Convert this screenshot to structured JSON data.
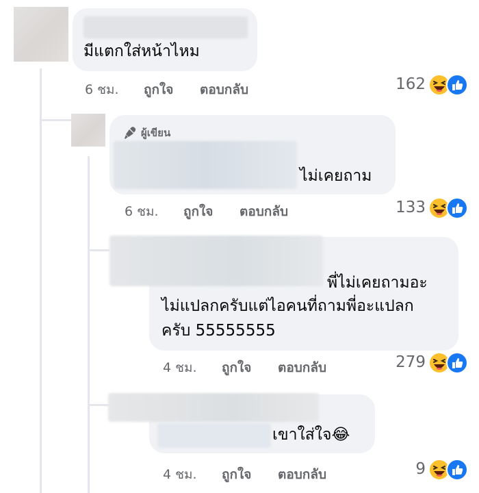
{
  "comments": [
    {
      "text": "มีแตกใส่หน้าไหม",
      "time": "6 ชม.",
      "like": "ถูกใจ",
      "reply": "ตอบกลับ",
      "reactions": "162"
    },
    {
      "badge": "ผู้เขียน",
      "text": "ไม่เคยถาม",
      "time": "6 ชม.",
      "like": "ถูกใจ",
      "reply": "ตอบกลับ",
      "reactions": "133"
    },
    {
      "lines": [
        "พี่ไม่เคยถามอะ",
        "ไม่แปลกครับแต่ไอคนที่ถามพี่อะแปลก",
        "ครับ 55555555"
      ],
      "time": "4 ชม.",
      "like": "ถูกใจ",
      "reply": "ตอบกลับ",
      "reactions": "279"
    },
    {
      "text": "เขาใส่ใจ",
      "emoji": "😂",
      "time": "4 ชม.",
      "like": "ถูกใจ",
      "reply": "ตอบกลับ",
      "reactions": "9"
    }
  ],
  "icons": {
    "reaction_haha": "haha-reaction-icon",
    "reaction_like": "like-reaction-icon",
    "author_badge": "microphone-icon"
  },
  "colors": {
    "bubble": "#f0f2f5",
    "meta": "#65676b",
    "like_blue": "#1877f2",
    "haha_yellow": "#fcc02d"
  }
}
